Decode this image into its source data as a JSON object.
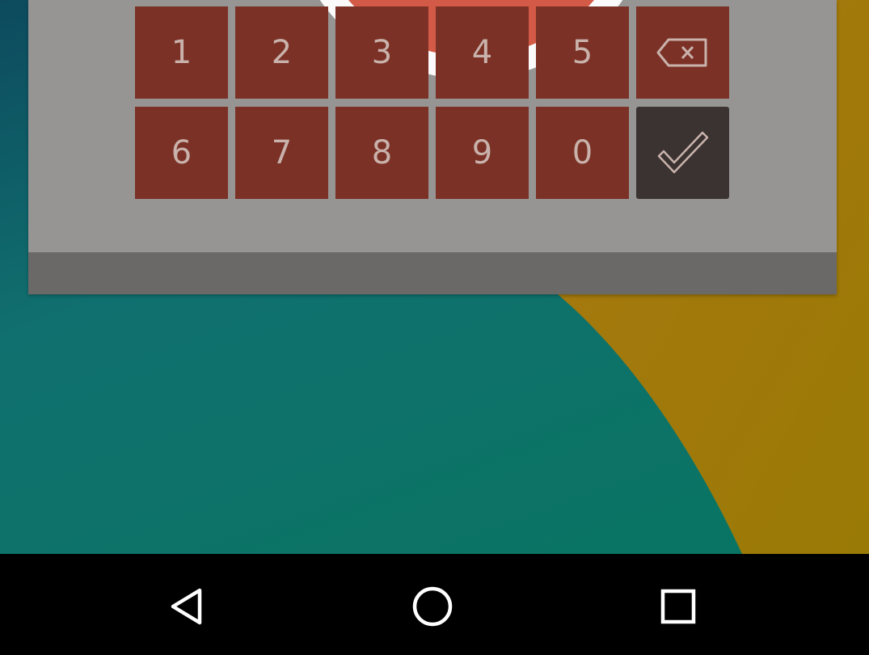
{
  "keypad": {
    "keys": [
      "1",
      "2",
      "3",
      "4",
      "5",
      "6",
      "7",
      "8",
      "9",
      "0"
    ],
    "backspace_icon": "backspace-icon",
    "enter_icon": "checkmark-icon"
  },
  "navbar": {
    "back_icon": "back-triangle-icon",
    "home_icon": "home-circle-icon",
    "recents_icon": "recents-square-icon"
  },
  "colors": {
    "key_bg": "#7b3126",
    "key_text": "#c9b2ab",
    "done_key_bg": "#3a3331",
    "dialog_bg": "#979593",
    "dialog_footer": "#6a6968",
    "accent_circle": "#d35a47",
    "wallpaper_teal": "#0c7366",
    "wallpaper_gold": "#a27a14"
  }
}
